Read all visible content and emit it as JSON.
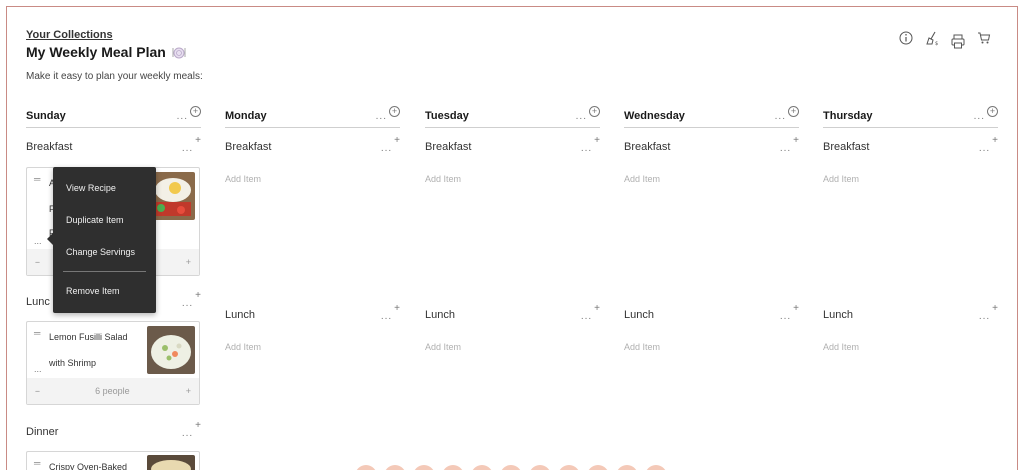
{
  "header": {
    "collections_link": "Your Collections",
    "title": "My Weekly Meal Plan",
    "subtitle": "Make it easy to plan your weekly meals:"
  },
  "toolbar_icons": [
    "info-icon",
    "broom-icon",
    "print-icon",
    "cart-icon"
  ],
  "days": [
    {
      "name": "Sunday",
      "meals": [
        "Breakfast",
        "Lunch",
        "Dinner"
      ]
    },
    {
      "name": "Monday",
      "meals": [
        "Breakfast",
        "Lunch"
      ]
    },
    {
      "name": "Tuesday",
      "meals": [
        "Breakfast",
        "Lunch"
      ]
    },
    {
      "name": "Wednesday",
      "meals": [
        "Breakfast",
        "Lunch"
      ]
    },
    {
      "name": "Thursday",
      "meals": [
        "Breakfast",
        "Lunch"
      ]
    }
  ],
  "meal_labels": {
    "breakfast": "Breakfast",
    "lunch": "Lunch",
    "dinner": "Dinner",
    "lunch_partial": "Lunc"
  },
  "add_item_label": "Add Item",
  "cards": {
    "sunday_breakfast": {
      "partial_title_lines": [
        "A",
        "F",
        "F"
      ]
    },
    "sunday_lunch": {
      "title_lines": [
        "Lemon Fusilli Salad",
        "with Shrimp"
      ],
      "servings": "6 people"
    },
    "sunday_dinner": {
      "title_lines": [
        "Crispy Oven-Baked"
      ]
    }
  },
  "context_menu": {
    "items": [
      "View Recipe",
      "Duplicate Item",
      "Change Servings",
      "Remove Item"
    ]
  },
  "colors": {
    "frame_border": "#c98b85",
    "menu_bg": "#2f2f2f",
    "pager_dot": "#f4c9b8"
  }
}
